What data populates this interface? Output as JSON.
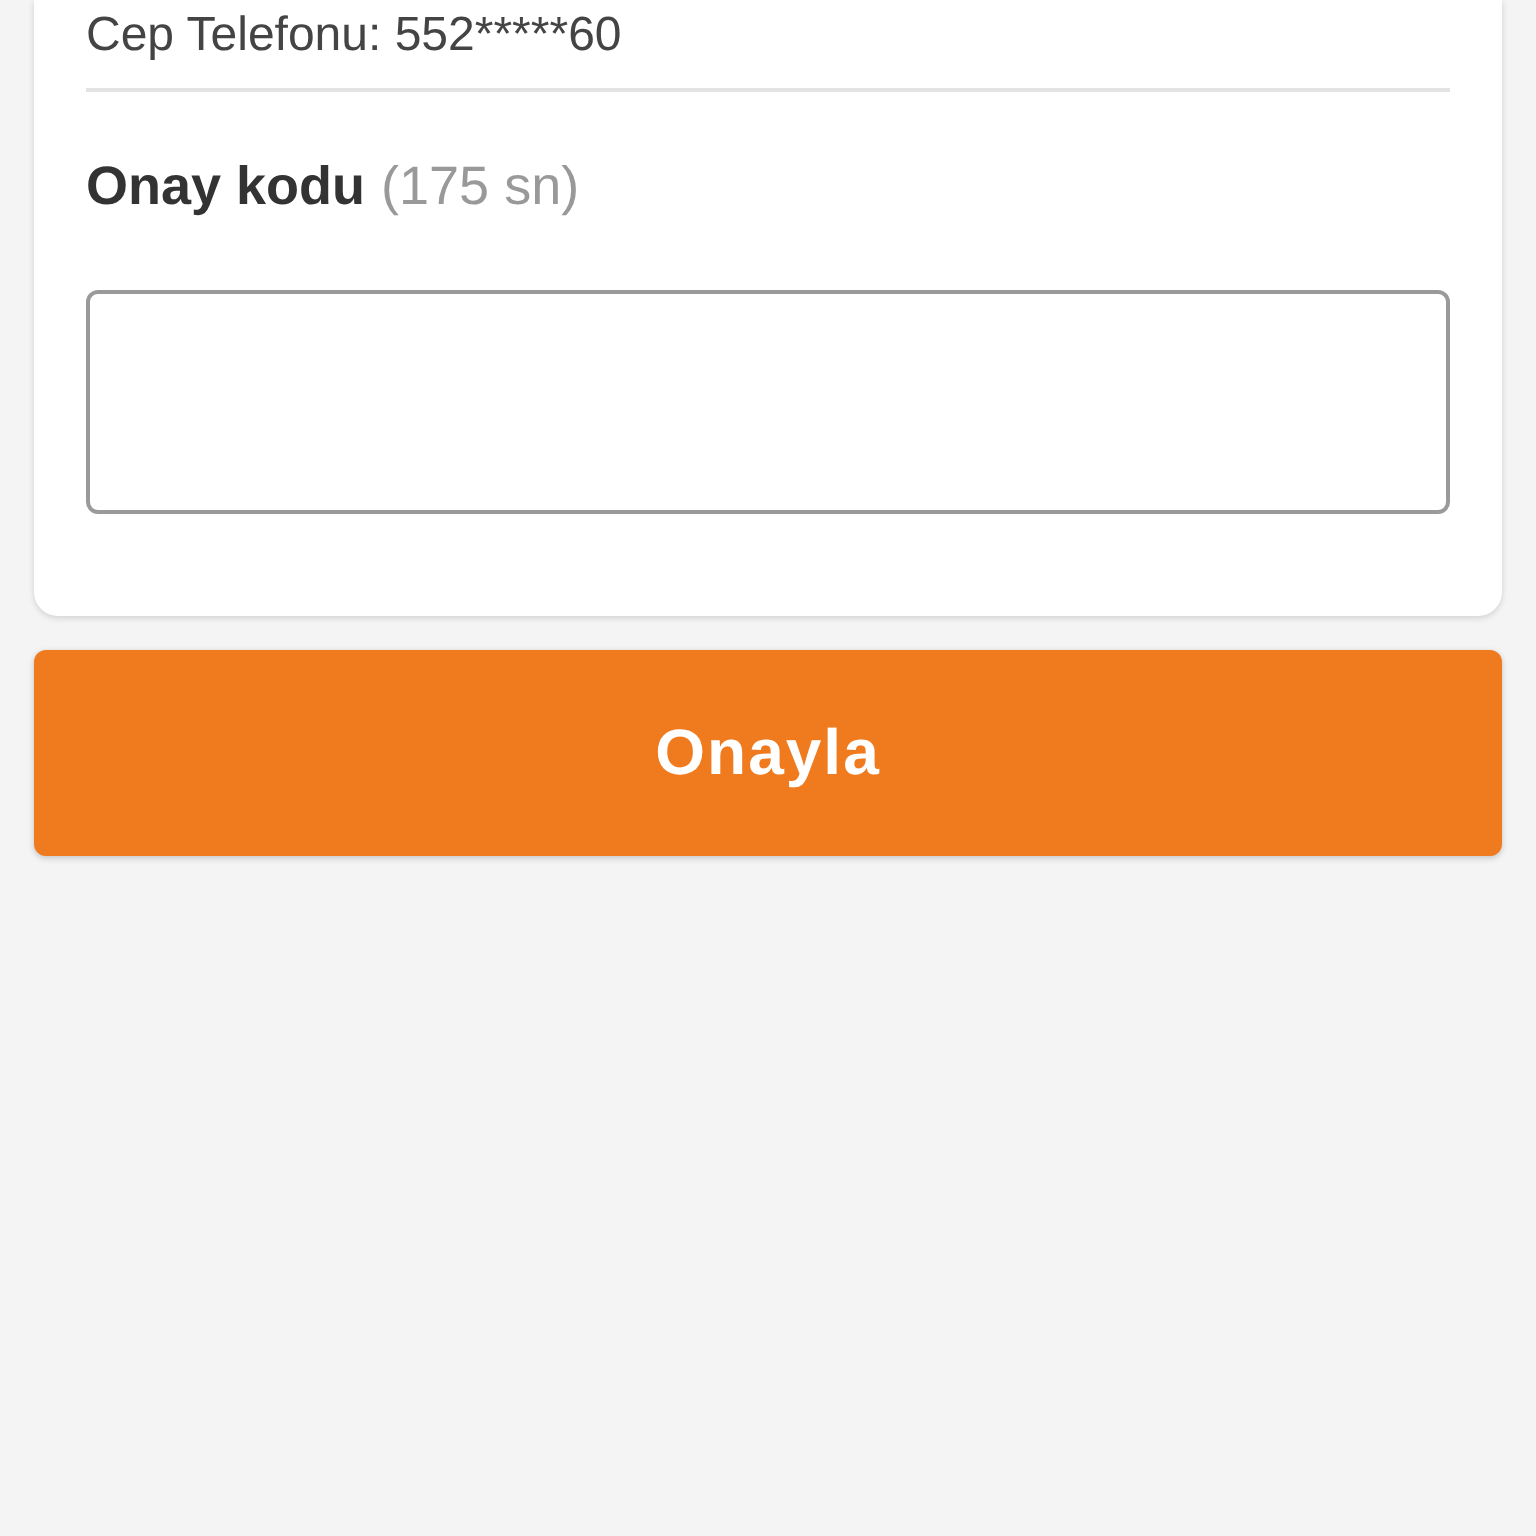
{
  "phone_line": "Cep Telefonu: 552*****60",
  "code_field": {
    "label": "Onay kodu",
    "timer": "(175 sn)"
  },
  "confirm_button": "Onayla"
}
